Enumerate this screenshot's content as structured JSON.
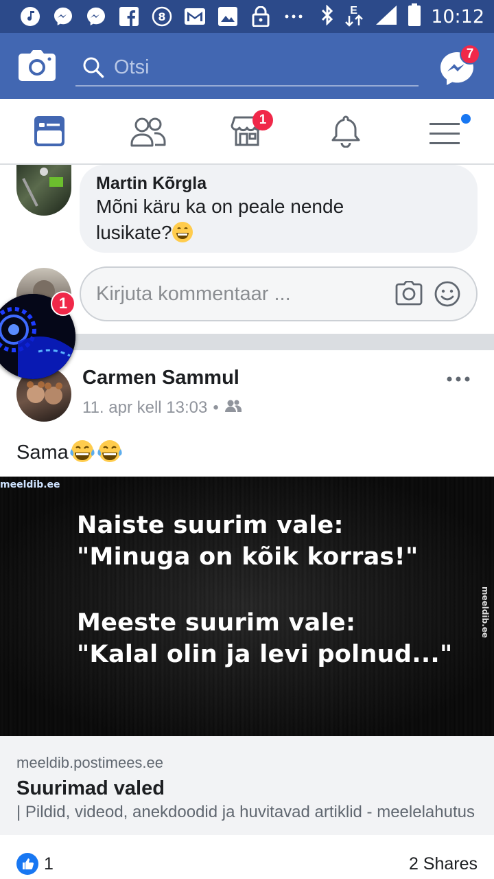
{
  "status_bar": {
    "time": "10:12",
    "network_label": "E",
    "left_icons": [
      "music-icon",
      "messenger-icon",
      "messenger-icon",
      "facebook-icon",
      "number-8-icon",
      "gmail-icon",
      "image-icon",
      "lock-icon",
      "more-dots-icon"
    ],
    "right_icons": [
      "bluetooth-icon",
      "signal-icon",
      "battery-icon"
    ]
  },
  "app_bar": {
    "search_placeholder": "Otsi",
    "messenger_badge": "7",
    "bg_color": "#4267b2"
  },
  "tabs": [
    {
      "name": "news-feed",
      "active": true,
      "badge": ""
    },
    {
      "name": "friends",
      "active": false,
      "badge": ""
    },
    {
      "name": "marketplace",
      "active": false,
      "badge": "1"
    },
    {
      "name": "notifications",
      "active": false,
      "badge": ""
    },
    {
      "name": "menu",
      "active": false,
      "badge": ""
    }
  ],
  "comment": {
    "author": "Martin Kõrgla",
    "text": "Mõni käru ka on peale nende lusikate?"
  },
  "compose": {
    "placeholder": "Kirjuta kommentaar ..."
  },
  "chat_head": {
    "badge": "1"
  },
  "post": {
    "author": "Carmen Sammul",
    "timestamp": "11. apr kell 13:03",
    "separator": "•",
    "text": "Sama",
    "image": {
      "watermark_top": "meeldib.ee",
      "watermark_side": "meeldib.ee",
      "lines": [
        "Naiste suurim vale:",
        "\"Minuga on kõik korras!\"",
        "Meeste suurim vale:",
        "\"Kalal olin ja levi polnud...\""
      ]
    },
    "link": {
      "domain": "meeldib.postimees.ee",
      "title": "Suurimad valed",
      "description": "| Pildid, videod, anekdoodid ja huvitavad artiklid - meelelahutus"
    },
    "like_count": "1",
    "shares": "2 Shares"
  },
  "colors": {
    "accent": "#4267b2",
    "status_bar": "#2c4a8a",
    "badge": "#f02849",
    "like_blue": "#1877f2"
  }
}
